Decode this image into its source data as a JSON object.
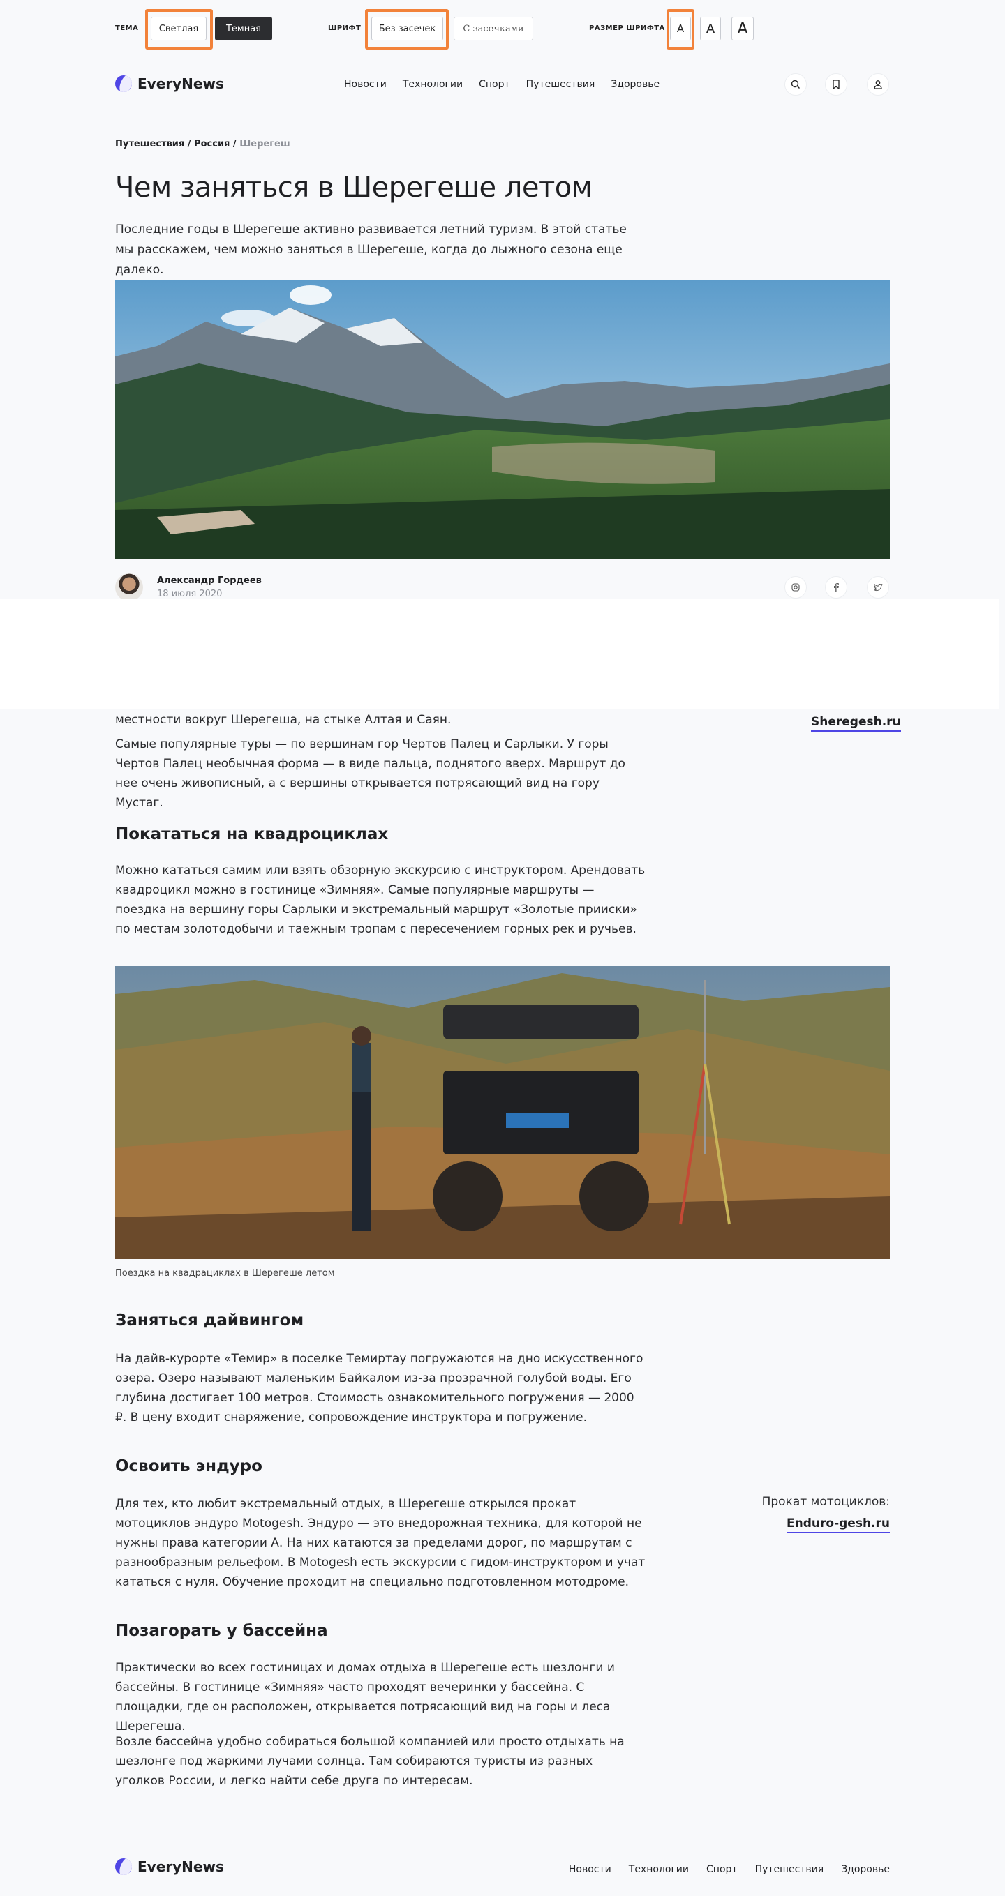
{
  "settings": {
    "theme_label": "ТЕМА",
    "theme_light": "Светлая",
    "theme_dark": "Темная",
    "font_label": "ШРИФТ",
    "font_sans": "Без засечек",
    "font_serif": "С засечками",
    "size_label": "РАЗМЕР ШРИФТА",
    "size_glyph": "A"
  },
  "header": {
    "logo": "EveryNews",
    "nav": [
      "Новости",
      "Технологии",
      "Спорт",
      "Путешествия",
      "Здоровье"
    ]
  },
  "article": {
    "breadcrumb": [
      "Путешествия",
      "Россия",
      "Шерегеш"
    ],
    "title": "Чем заняться в Шерегеше летом",
    "lead": "Последние годы в Шерегеше активно развивается летний туризм. В этой статье мы расскажем, чем можно заняться в Шерегеше, когда до лыжного сезона еще далеко.",
    "author_name": "Александр Гордеев",
    "author_date": "18 июля 2020",
    "p_partial": "местности вокруг Шерегеша, на стыке Алтая и Саян.",
    "p_tours": "Самые популярные туры — по вершинам гор Чертов Палец и Сарлыки. У горы Чертов Палец необычная форма — в виде пальца, поднятого вверх. Маршрут до нее очень живописный, а с вершины открывается потрясающий вид на гору Мустаг.",
    "side_link_1": "Sheregesh.ru",
    "h_quad": "Покататься на квадроциклах",
    "p_quad": "Можно кататься самим или взять обзорную экскурсию с инструктором.  Арендовать квадроцикл можно в гостинице «Зимняя». Самые популярные маршруты — поездка на вершину горы Сарлыки и экстремальный маршрут «Золотые прииски» по местам золотодобычи и таежным тропам с пересечением горных рек и ручьев.",
    "caption_quad": "Поездка на квадрациклах в Шерегеше летом",
    "h_dive": "Заняться дайвингом",
    "p_dive": "На дайв-курорте «Темир» в поселке Темиртау погружаются на дно искусственного озера. Озеро называют маленьким Байкалом из-за прозрачной голубой воды. Его глубина достигает 100 метров. Стоимость ознакомительного погружения — 2000 ₽. В цену входит снаряжение, сопровождение инструктора и погружение.",
    "h_enduro": "Освоить эндуро",
    "p_enduro": "Для тех, кто любит экстремальный отдых, в Шерегеше открылся прокат мотоциклов эндуро Motogesh. Эндуро — это внедорожная техника, для которой не нужны права категории А. На них катаются за пределами дорог, по маршрутам с разнообразным рельефом. В Motogesh есть экскурсии с гидом-инструктором и учат кататься с нуля. Обучение проходит на специально подготовленном мотодроме.",
    "side_label_2": "Прокат мотоциклов:",
    "side_link_2": "Enduro-gesh.ru",
    "h_pool": "Позагорать у бассейна",
    "p_pool_1": "Практически во всех гостиницах и домах отдыха в Шерегеше есть шезлонги и бассейны. В гостинице «Зимняя» часто проходят вечеринки у бассейна. С площадки, где он расположен, открывается потрясающий вид на горы и леса Шерегеша.",
    "p_pool_2": "Возле бассейна удобно собираться большой компанией или просто отдыхать на шезлонге под жаркими лучами солнца. Там собираются туристы из разных уголков России, и легко найти себе друга по интересам."
  },
  "footer": {
    "logo": "EveryNews",
    "nav": [
      "Новости",
      "Технологии",
      "Спорт",
      "Путешествия",
      "Здоровье"
    ]
  },
  "colors": {
    "accent": "#4f46e5",
    "highlight": "#f2823a"
  }
}
